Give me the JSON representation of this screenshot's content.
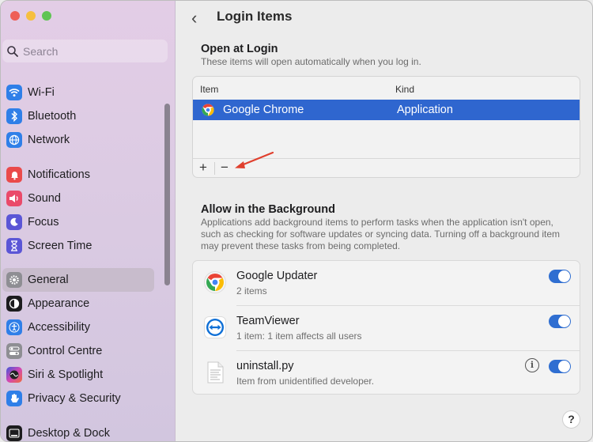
{
  "window": {
    "traffic_colors": {
      "close": "#ee5f58",
      "minimize": "#f6bf3f",
      "zoom": "#5fc453"
    }
  },
  "sidebar": {
    "search_placeholder": "Search",
    "items": [
      {
        "label": "Wi-Fi",
        "icon": "wifi-icon",
        "color": "#2f7fe8"
      },
      {
        "label": "Bluetooth",
        "icon": "bluetooth-icon",
        "color": "#2f7fe8"
      },
      {
        "label": "Network",
        "icon": "globe-icon",
        "color": "#2f7fe8"
      },
      {
        "label": "Notifications",
        "icon": "bell-icon",
        "color": "#ea4a4a"
      },
      {
        "label": "Sound",
        "icon": "speaker-icon",
        "color": "#ea4a6a"
      },
      {
        "label": "Focus",
        "icon": "moon-icon",
        "color": "#5b56d6"
      },
      {
        "label": "Screen Time",
        "icon": "hourglass-icon",
        "color": "#5b56d6"
      },
      {
        "label": "General",
        "icon": "gear-icon",
        "color": "#8e8e93",
        "active": true
      },
      {
        "label": "Appearance",
        "icon": "appearance-icon",
        "color": "#1c1c1e"
      },
      {
        "label": "Accessibility",
        "icon": "accessibility-icon",
        "color": "#2f7fe8"
      },
      {
        "label": "Control Centre",
        "icon": "toggles-icon",
        "color": "#8e8e93"
      },
      {
        "label": "Siri & Spotlight",
        "icon": "siri-icon",
        "color": "#b14fc5"
      },
      {
        "label": "Privacy & Security",
        "icon": "hand-icon",
        "color": "#2f7fe8"
      },
      {
        "label": "Desktop & Dock",
        "icon": "dock-icon",
        "color": "#1c1c1e"
      }
    ]
  },
  "header": {
    "back_glyph": "‹",
    "title": "Login Items"
  },
  "open_at_login": {
    "title": "Open at Login",
    "description": "These items will open automatically when you log in.",
    "columns": {
      "item": "Item",
      "kind": "Kind"
    },
    "rows": [
      {
        "item": "Google Chrome",
        "kind": "Application",
        "icon": "chrome-icon"
      }
    ],
    "add_label": "+",
    "remove_label": "−"
  },
  "background": {
    "title": "Allow in the Background",
    "description": "Applications add background items to perform tasks when the application isn't open, such as checking for software updates or syncing data. Turning off a background item may prevent these tasks from being completed.",
    "items": [
      {
        "name": "Google Updater",
        "sub": "2 items",
        "icon": "chrome-icon",
        "enabled": true
      },
      {
        "name": "TeamViewer",
        "sub": "1 item: 1 item affects all users",
        "icon": "teamviewer-icon",
        "enabled": true
      },
      {
        "name": "uninstall.py",
        "sub": "Item from unidentified developer.",
        "icon": "document-icon",
        "enabled": true,
        "info": "i"
      }
    ]
  },
  "help_label": "?",
  "accent_color": "#2f66cf",
  "annotation_arrow_color": "#e0402e"
}
